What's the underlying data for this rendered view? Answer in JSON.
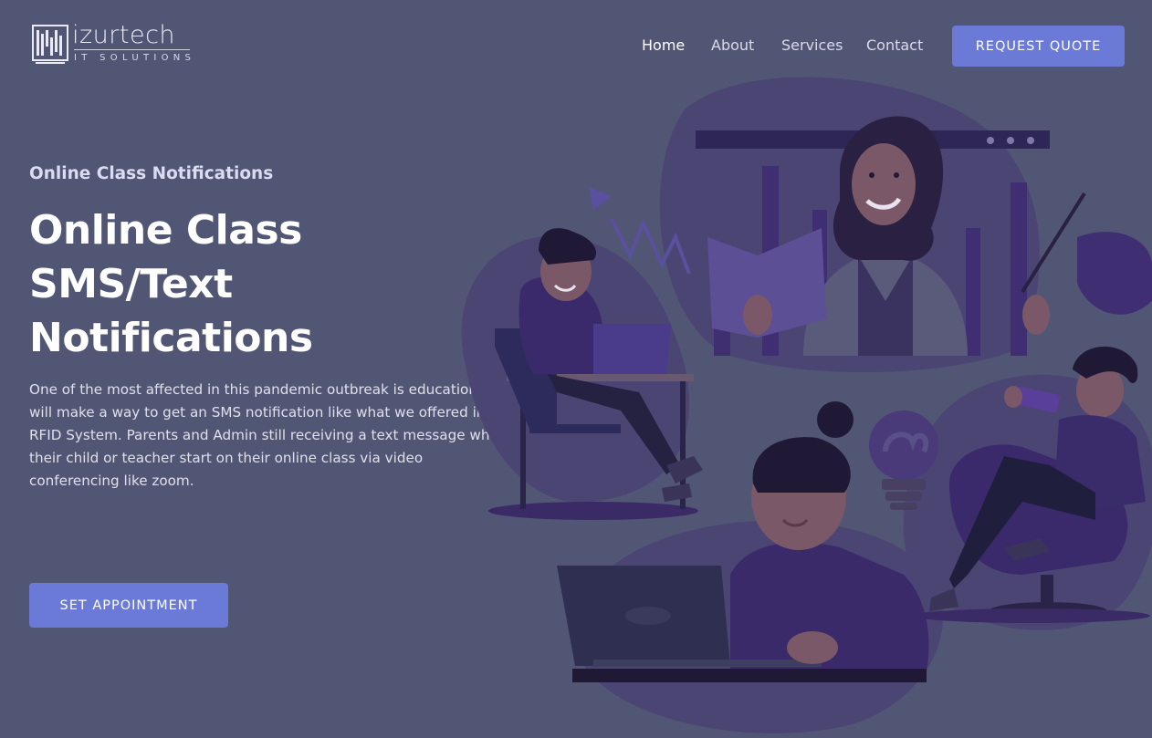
{
  "brand": {
    "name": "izurtech",
    "tagline": "IT SOLUTIONS"
  },
  "nav": {
    "items": [
      {
        "label": "Home",
        "active": true
      },
      {
        "label": "About",
        "active": false
      },
      {
        "label": "Services",
        "active": false
      },
      {
        "label": "Contact",
        "active": false
      }
    ],
    "cta_label": "REQUEST QUOTE"
  },
  "hero": {
    "eyebrow": "Online Class Notifications",
    "headline_lines": [
      "Online Class",
      "SMS/Text",
      "Notifications"
    ],
    "description": "One of the most affected in this pandemic outbreak is education. We will make a way to get an SMS notification like what we offered in RFID System. Parents and Admin still receiving a text message when their child or teacher start on their online class via video conferencing like zoom.",
    "cta_label": "SET APPOINTMENT"
  },
  "colors": {
    "background": "#525675",
    "accent": "#6b7ad6",
    "illustration_purple": "#4a3a7a"
  },
  "illustration": {
    "icons": [
      "teacher-video-call-icon",
      "student-laptop-icon",
      "student-desk-icon",
      "student-phone-icon",
      "lightbulb-icon",
      "growth-chart-icon"
    ]
  }
}
